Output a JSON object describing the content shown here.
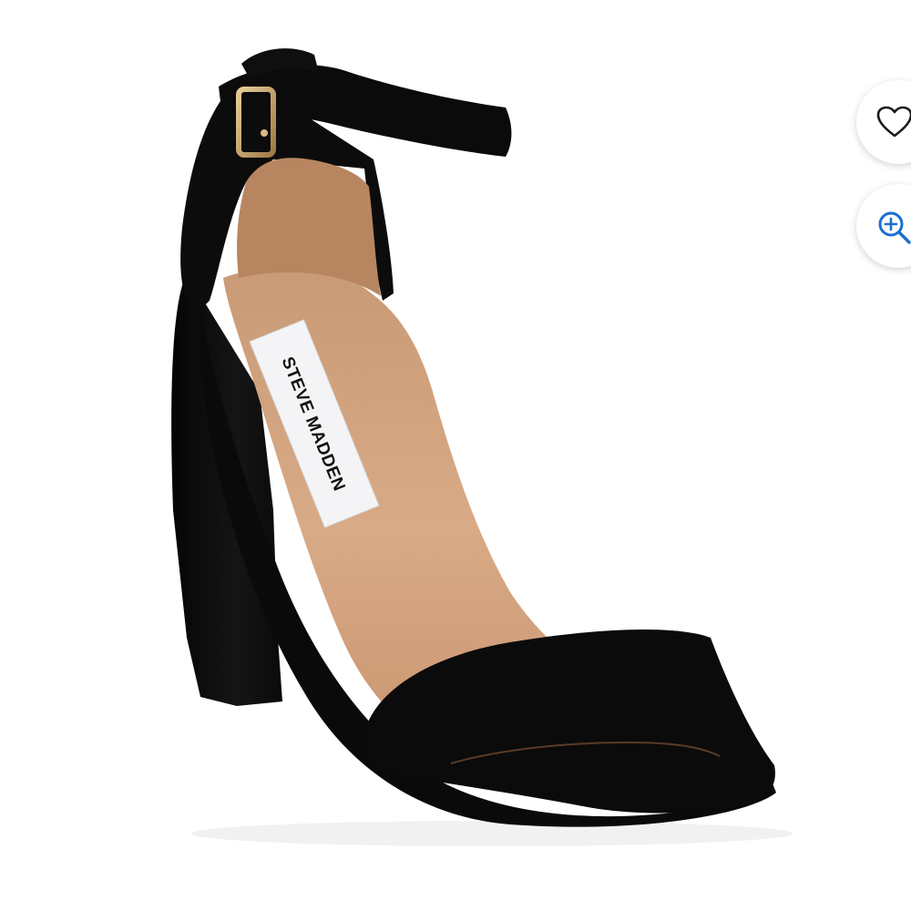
{
  "product": {
    "image_name": "black-block-heel-sandal",
    "brand_label": "STEVE MADDEN"
  },
  "actions": {
    "favorite_icon": "heart-outline-icon",
    "zoom_icon": "zoom-in-icon"
  },
  "colors": {
    "suede": "#0b0b0b",
    "footbed": "#d2a37f",
    "buckle": "#c9a56c",
    "zoom_accent": "#1a6fd1"
  }
}
